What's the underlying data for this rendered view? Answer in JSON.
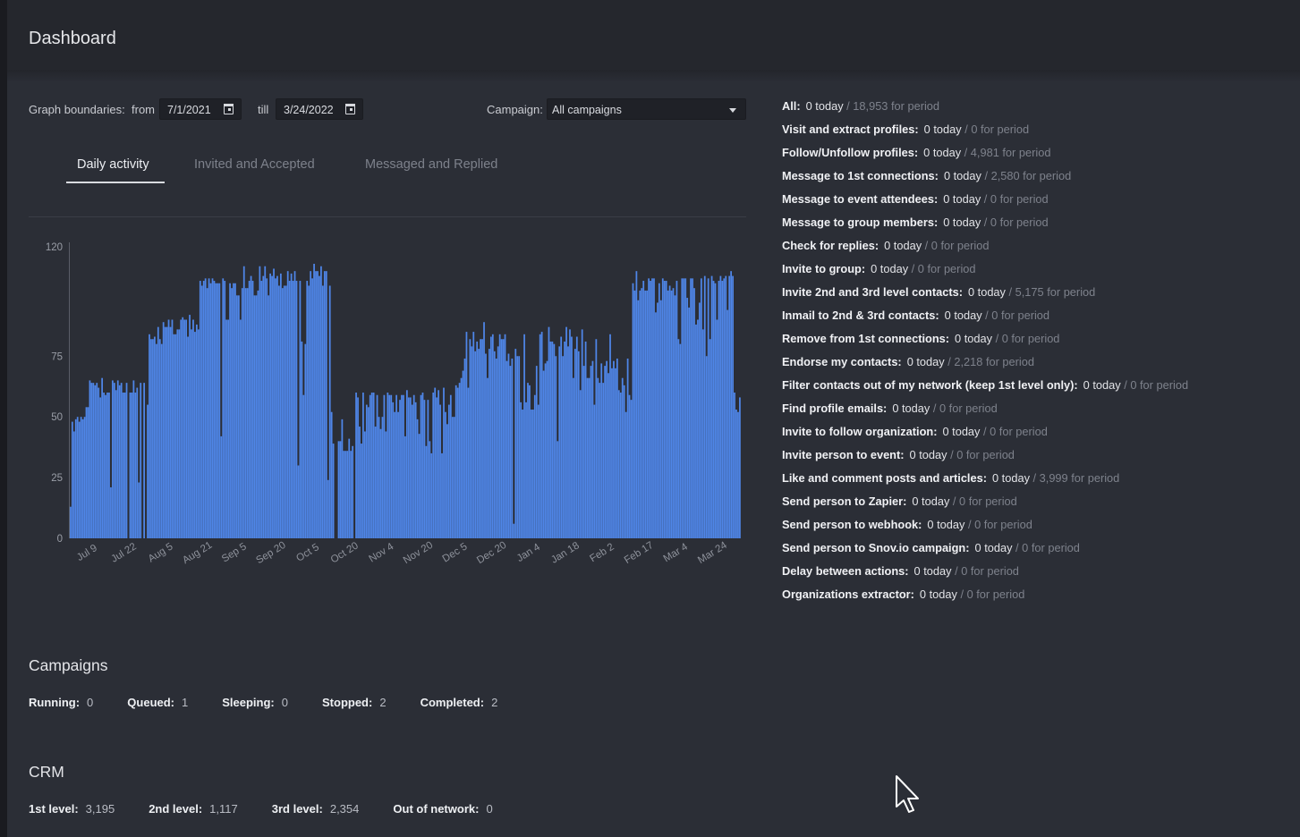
{
  "header": {
    "title": "Dashboard"
  },
  "filters": {
    "boundaries_label": "Graph boundaries:",
    "from_label": "from",
    "from_value": "7/1/2021",
    "till_label": "till",
    "till_value": "3/24/2022",
    "campaign_label": "Campaign:",
    "campaign_value": "All campaigns"
  },
  "tabs": [
    {
      "label": "Daily activity"
    },
    {
      "label": "Invited and Accepted"
    },
    {
      "label": "Messaged and Replied"
    }
  ],
  "chart_data": {
    "type": "bar",
    "title": "",
    "xlabel": "",
    "ylabel": "",
    "ylim": [
      0,
      120
    ],
    "yticks": [
      0,
      25,
      50,
      75,
      120
    ],
    "x_tick_labels": [
      "Jul 9",
      "Jul 22",
      "Aug 5",
      "Aug 21",
      "Sep 5",
      "Sep 20",
      "Oct 5",
      "Oct 20",
      "Nov 4",
      "Nov 20",
      "Dec 5",
      "Dec 20",
      "Jan 4",
      "Jan 18",
      "Feb 2",
      "Feb 17",
      "Mar 4",
      "Mar 24"
    ],
    "bar_color": "#4f86e8",
    "grid": false,
    "values": [
      13,
      48,
      44,
      49,
      50,
      48,
      50,
      49,
      50,
      54,
      54,
      65,
      64,
      64,
      63,
      64,
      62,
      58,
      66,
      60,
      59,
      60,
      60,
      21,
      65,
      64,
      61,
      65,
      63,
      64,
      60,
      60,
      64,
      0,
      60,
      60,
      65,
      60,
      62,
      23,
      64,
      0,
      64,
      0,
      55,
      84,
      82,
      82,
      83,
      80,
      87,
      82,
      80,
      89,
      87,
      87,
      90,
      87,
      90,
      84,
      84,
      86,
      86,
      90,
      91,
      90,
      90,
      83,
      92,
      86,
      90,
      85,
      88,
      86,
      106,
      104,
      106,
      107,
      103,
      107,
      105,
      107,
      106,
      105,
      105,
      105,
      42,
      107,
      106,
      90,
      90,
      105,
      103,
      105,
      105,
      100,
      100,
      90,
      103,
      112,
      103,
      103,
      106,
      108,
      106,
      100,
      100,
      102,
      112,
      106,
      108,
      112,
      107,
      100,
      109,
      108,
      111,
      107,
      108,
      104,
      109,
      103,
      104,
      104,
      110,
      106,
      109,
      106,
      110,
      106,
      30,
      106,
      81,
      59,
      80,
      106,
      104,
      110,
      107,
      113,
      110,
      110,
      108,
      112,
      104,
      110,
      110,
      24,
      104,
      52,
      39,
      0,
      0,
      40,
      40,
      49,
      36,
      36,
      36,
      41,
      36,
      38,
      0,
      60,
      58,
      46,
      39,
      60,
      44,
      55,
      54,
      59,
      60,
      60,
      46,
      59,
      50,
      45,
      50,
      59,
      44,
      60,
      59,
      59,
      56,
      52,
      59,
      52,
      57,
      59,
      59,
      42,
      61,
      58,
      58,
      55,
      59,
      56,
      49,
      43,
      59,
      60,
      57,
      38,
      57,
      40,
      35,
      60,
      62,
      58,
      61,
      55,
      35,
      62,
      52,
      47,
      55,
      59,
      50,
      50,
      63,
      62,
      64,
      66,
      69,
      74,
      85,
      62,
      82,
      79,
      85,
      77,
      81,
      78,
      82,
      82,
      89,
      76,
      66,
      78,
      83,
      84,
      77,
      74,
      79,
      84,
      82,
      82,
      84,
      73,
      76,
      71,
      74,
      6,
      78,
      75,
      75,
      56,
      53,
      84,
      56,
      64,
      63,
      53,
      53,
      59,
      71,
      55,
      84,
      85,
      69,
      72,
      73,
      87,
      81,
      81,
      80,
      75,
      40,
      79,
      83,
      75,
      81,
      87,
      79,
      86,
      83,
      66,
      78,
      83,
      77,
      61,
      86,
      71,
      81,
      66,
      66,
      71,
      73,
      55,
      82,
      66,
      64,
      72,
      64,
      71,
      73,
      68,
      84,
      70,
      73,
      70,
      74,
      61,
      60,
      66,
      63,
      52,
      74,
      59,
      57,
      105,
      102,
      110,
      98,
      102,
      103,
      106,
      102,
      102,
      107,
      106,
      107,
      107,
      93,
      97,
      105,
      98,
      107,
      106,
      106,
      102,
      104,
      102,
      103,
      100,
      106,
      82,
      80,
      107,
      107,
      107,
      99,
      95,
      107,
      107,
      103,
      88,
      90,
      97,
      107,
      86,
      108,
      75,
      107,
      82,
      108,
      106,
      105,
      90,
      106,
      108,
      106,
      107,
      108,
      94,
      108,
      110,
      108,
      60,
      53,
      52,
      58
    ]
  },
  "stats": [
    {
      "name": "All:",
      "today": "0 today",
      "period": "18,953 for period"
    },
    {
      "name": "Visit and extract profiles:",
      "today": "0 today",
      "period": "0 for period"
    },
    {
      "name": "Follow/Unfollow profiles:",
      "today": "0 today",
      "period": "4,981 for period"
    },
    {
      "name": "Message to 1st connections:",
      "today": "0 today",
      "period": "2,580 for period"
    },
    {
      "name": "Message to event attendees:",
      "today": "0 today",
      "period": "0 for period"
    },
    {
      "name": "Message to group members:",
      "today": "0 today",
      "period": "0 for period"
    },
    {
      "name": "Check for replies:",
      "today": "0 today",
      "period": "0 for period"
    },
    {
      "name": "Invite to group:",
      "today": "0 today",
      "period": "0 for period"
    },
    {
      "name": "Invite 2nd and 3rd level contacts:",
      "today": "0 today",
      "period": "5,175 for period"
    },
    {
      "name": "Inmail to 2nd & 3rd contacts:",
      "today": "0 today",
      "period": "0 for period"
    },
    {
      "name": "Remove from 1st connections:",
      "today": "0 today",
      "period": "0 for period"
    },
    {
      "name": "Endorse my contacts:",
      "today": "0 today",
      "period": "2,218 for period"
    },
    {
      "name": "Filter contacts out of my network (keep 1st level only):",
      "today": "0 today",
      "period": "0 for period"
    },
    {
      "name": "Find profile emails:",
      "today": "0 today",
      "period": "0 for period"
    },
    {
      "name": "Invite to follow organization:",
      "today": "0 today",
      "period": "0 for period"
    },
    {
      "name": "Invite person to event:",
      "today": "0 today",
      "period": "0 for period"
    },
    {
      "name": "Like and comment posts and articles:",
      "today": "0 today",
      "period": "3,999 for period"
    },
    {
      "name": "Send person to Zapier:",
      "today": "0 today",
      "period": "0 for period"
    },
    {
      "name": "Send person to webhook:",
      "today": "0 today",
      "period": "0 for period"
    },
    {
      "name": "Send person to Snov.io campaign:",
      "today": "0 today",
      "period": "0 for period"
    },
    {
      "name": "Delay between actions:",
      "today": "0 today",
      "period": "0 for period"
    },
    {
      "name": "Organizations extractor:",
      "today": "0 today",
      "period": "0 for period"
    }
  ],
  "campaigns": {
    "title": "Campaigns",
    "items": [
      {
        "label": "Running:",
        "value": "0"
      },
      {
        "label": "Queued:",
        "value": "1"
      },
      {
        "label": "Sleeping:",
        "value": "0"
      },
      {
        "label": "Stopped:",
        "value": "2"
      },
      {
        "label": "Completed:",
        "value": "2"
      }
    ]
  },
  "crm": {
    "title": "CRM",
    "items": [
      {
        "label": "1st level:",
        "value": "3,195"
      },
      {
        "label": "2nd level:",
        "value": "1,117"
      },
      {
        "label": "3rd level:",
        "value": "2,354"
      },
      {
        "label": "Out of network:",
        "value": "0"
      }
    ]
  }
}
